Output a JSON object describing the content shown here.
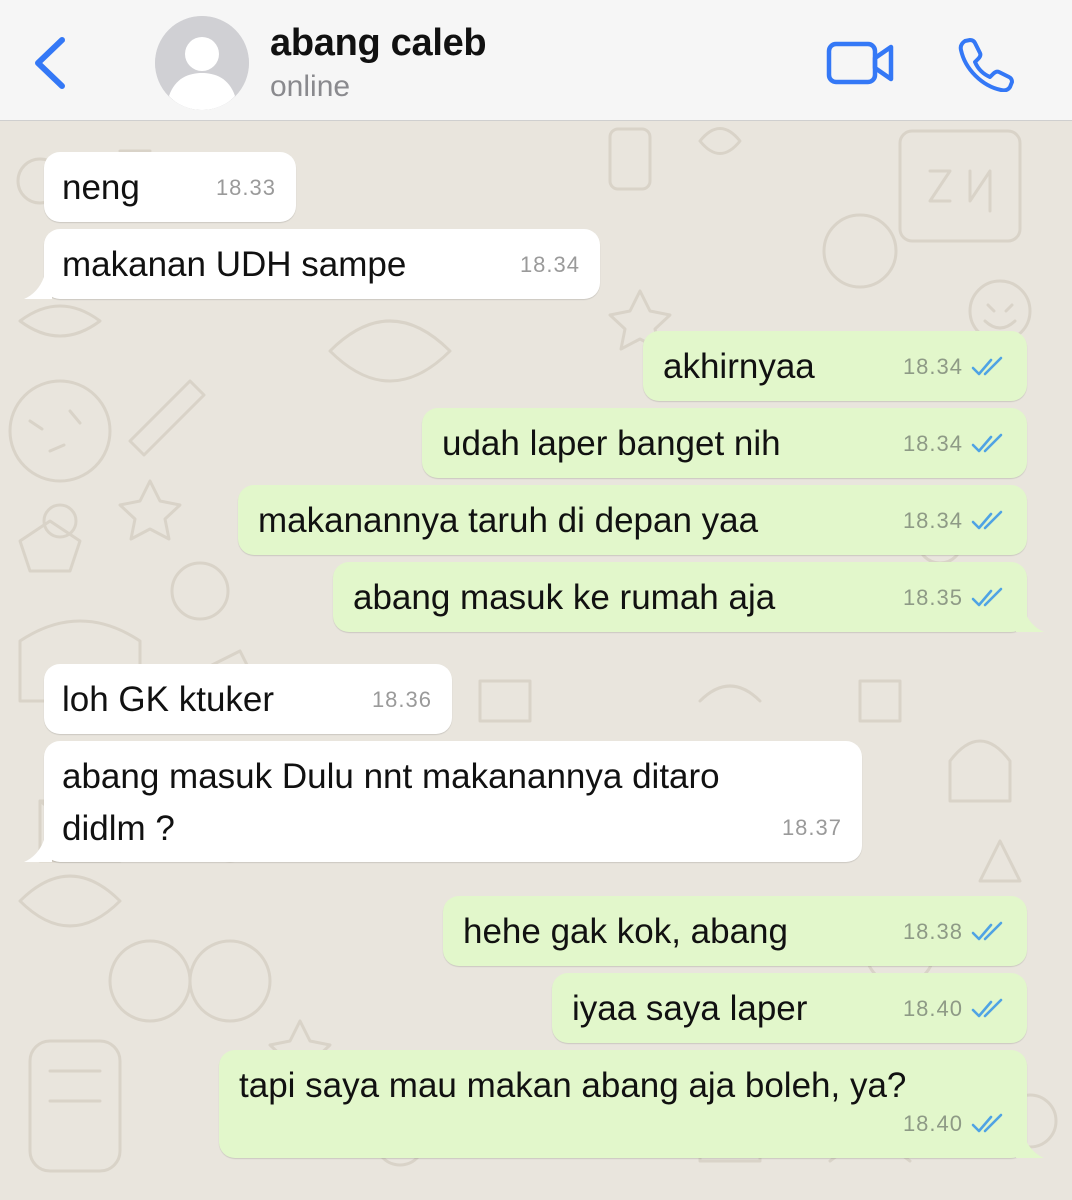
{
  "header": {
    "contact_name": "abang caleb",
    "contact_status": "online",
    "back_icon": "chevron-left-icon",
    "video_icon": "video-camera-icon",
    "call_icon": "phone-icon",
    "accent_color": "#3478f6"
  },
  "colors": {
    "incoming_bubble": "#ffffff",
    "outgoing_bubble": "#e2f7cb",
    "read_ticks": "#4fa3e4",
    "wallpaper": "#e9e5dd"
  },
  "messages": [
    {
      "direction": "in",
      "text": "neng",
      "time": "18.33"
    },
    {
      "direction": "in",
      "text": "makanan UDH sampe",
      "time": "18.34"
    },
    {
      "direction": "out",
      "text": "akhirnyaa",
      "time": "18.34",
      "status": "read"
    },
    {
      "direction": "out",
      "text": "udah laper banget nih",
      "time": "18.34",
      "status": "read"
    },
    {
      "direction": "out",
      "text": "makanannya taruh di depan yaa",
      "time": "18.34",
      "status": "read"
    },
    {
      "direction": "out",
      "text": "abang masuk ke rumah aja",
      "time": "18.35",
      "status": "read"
    },
    {
      "direction": "in",
      "text": "loh GK ktuker",
      "time": "18.36"
    },
    {
      "direction": "in",
      "text": "abang masuk Dulu nnt makanannya ditaro\ndidlm ?",
      "time": "18.37"
    },
    {
      "direction": "out",
      "text": "hehe gak kok, abang",
      "time": "18.38",
      "status": "read"
    },
    {
      "direction": "out",
      "text": "iyaa saya laper",
      "time": "18.40",
      "status": "read"
    },
    {
      "direction": "out",
      "text": "tapi saya mau makan abang aja boleh, ya?",
      "time": "18.40",
      "status": "read"
    }
  ]
}
